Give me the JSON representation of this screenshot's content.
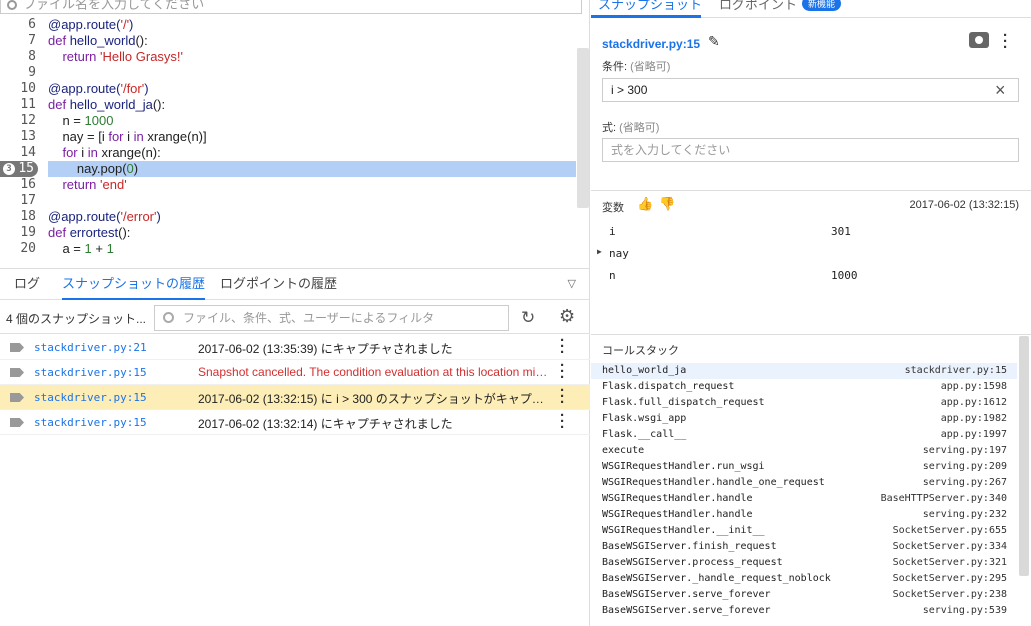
{
  "search": {
    "placeholder": "ファイル名を入力してください"
  },
  "code": [
    {
      "ln": "6",
      "html": "<span class=\"fn\">@app.route(</span><span class=\"str\">'/'</span><span class=\"fn\">)</span>"
    },
    {
      "ln": "7",
      "html": "<span class=\"kw\">def</span> <span class=\"fn\">hello_world</span>():"
    },
    {
      "ln": "8",
      "html": "    <span class=\"kw\">return</span> <span class=\"str\">'Hello Grasys!'</span>"
    },
    {
      "ln": "9",
      "html": ""
    },
    {
      "ln": "10",
      "html": "<span class=\"fn\">@app.route(</span><span class=\"str\">'/for'</span><span class=\"fn\">)</span>"
    },
    {
      "ln": "11",
      "html": "<span class=\"kw\">def</span> <span class=\"fn\">hello_world_ja</span>():"
    },
    {
      "ln": "12",
      "html": "    n = <span class=\"num\">1000</span>"
    },
    {
      "ln": "13",
      "html": "    nay = [i <span class=\"kw\">for</span> i <span class=\"kw\">in</span> xrange(n)]"
    },
    {
      "ln": "14",
      "html": "    <span class=\"kw\">for</span> i <span class=\"kw\">in</span> xrange(n):"
    },
    {
      "ln": "15",
      "html": "        nay.pop(<span class=\"num\">0</span>)",
      "hl": true,
      "bp": "3"
    },
    {
      "ln": "16",
      "html": "    <span class=\"kw\">return</span> <span class=\"str\">'end'</span>"
    },
    {
      "ln": "17",
      "html": ""
    },
    {
      "ln": "18",
      "html": "<span class=\"fn\">@app.route(</span><span class=\"str\">'/error'</span><span class=\"fn\">)</span>"
    },
    {
      "ln": "19",
      "html": "<span class=\"kw\">def</span> <span class=\"fn\">errortest</span>():"
    },
    {
      "ln": "20",
      "html": "    a = <span class=\"num\">1</span> + <span class=\"num\">1</span>"
    }
  ],
  "tabs": {
    "log": "ログ",
    "snapshots": "スナップショットの履歴",
    "logpoints": "ログポイントの履歴"
  },
  "filter": {
    "count": "4 個のスナップショット...",
    "placeholder": "ファイル、条件、式、ユーザーによるフィルタ"
  },
  "snapshots": [
    {
      "file": "stackdriver.py:21",
      "msg": "2017-06-02 (13:35:39) にキャプチャされました",
      "err": false,
      "sel": false
    },
    {
      "file": "stackdriver.py:15",
      "msg": "Snapshot cancelled. The condition evaluation at this location might affect application performance.",
      "err": true,
      "sel": false
    },
    {
      "file": "stackdriver.py:15",
      "msg": "2017-06-02 (13:32:15) に i > 300 のスナップショットがキャプチャされました",
      "err": false,
      "sel": true
    },
    {
      "file": "stackdriver.py:15",
      "msg": "2017-06-02 (13:32:14) にキャプチャされました",
      "err": false,
      "sel": false
    }
  ],
  "right": {
    "tab_snapshot": "スナップショット",
    "tab_logpoint": "ログポイント",
    "new_badge": "新機能",
    "file": "stackdriver.py:15",
    "cond_label": "条件:",
    "optional": "(省略可)",
    "cond_value": "i > 300",
    "expr_label": "式:",
    "expr_placeholder": "式を入力してください",
    "vars_title": "変数",
    "vars_time": "2017-06-02 (13:32:15)",
    "stack_title": "コールスタック"
  },
  "vars": [
    {
      "name": "i",
      "value": "301",
      "expandable": false
    },
    {
      "name": "nay",
      "value": "",
      "expandable": true
    },
    {
      "name": "n",
      "value": "1000",
      "expandable": false
    }
  ],
  "stack": [
    {
      "name": "hello_world_ja",
      "loc": "stackdriver.py:15",
      "sel": true
    },
    {
      "name": "Flask.dispatch_request",
      "loc": "app.py:1598"
    },
    {
      "name": "Flask.full_dispatch_request",
      "loc": "app.py:1612"
    },
    {
      "name": "Flask.wsgi_app",
      "loc": "app.py:1982"
    },
    {
      "name": "Flask.__call__",
      "loc": "app.py:1997"
    },
    {
      "name": "execute",
      "loc": "serving.py:197"
    },
    {
      "name": "WSGIRequestHandler.run_wsgi",
      "loc": "serving.py:209"
    },
    {
      "name": "WSGIRequestHandler.handle_one_request",
      "loc": "serving.py:267"
    },
    {
      "name": "WSGIRequestHandler.handle",
      "loc": "BaseHTTPServer.py:340"
    },
    {
      "name": "WSGIRequestHandler.handle",
      "loc": "serving.py:232"
    },
    {
      "name": "WSGIRequestHandler.__init__",
      "loc": "SocketServer.py:655"
    },
    {
      "name": "BaseWSGIServer.finish_request",
      "loc": "SocketServer.py:334"
    },
    {
      "name": "BaseWSGIServer.process_request",
      "loc": "SocketServer.py:321"
    },
    {
      "name": "BaseWSGIServer._handle_request_noblock",
      "loc": "SocketServer.py:295"
    },
    {
      "name": "BaseWSGIServer.serve_forever",
      "loc": "SocketServer.py:238"
    },
    {
      "name": "BaseWSGIServer.serve_forever",
      "loc": "serving.py:539"
    }
  ]
}
